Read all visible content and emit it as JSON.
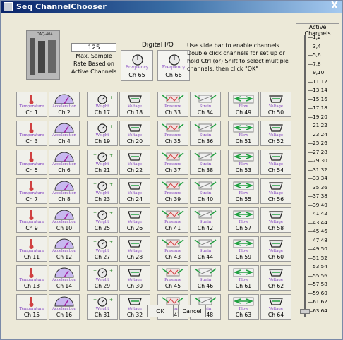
{
  "window": {
    "title": "Seq ChannelChooser",
    "close_glyph": "X"
  },
  "device": {
    "label": "DAQ-404",
    "icon": "daq-device-icon"
  },
  "sample_rate": {
    "value": "125",
    "label": "Max. Sample Rate Based on Active Channels"
  },
  "digital_io": {
    "title": "Digital I/O",
    "channels": [
      {
        "label": "Ch 65",
        "type": "Frequency",
        "icon": "frequency-icon"
      },
      {
        "label": "Ch 66",
        "type": "Frequency",
        "icon": "frequency-icon"
      }
    ]
  },
  "instructions": "Use slide bar to enable channels. Double click channels for set up or hold Ctrl (or) Shift to select multiple channels, then click \"OK\"",
  "active_channels": {
    "title": "Active Channels",
    "level": 0,
    "ticks": [
      "1,2",
      "3,4",
      "5,6",
      "7,8",
      "9,10",
      "11,12",
      "13,14",
      "15,16",
      "17,18",
      "19,20",
      "21,22",
      "23,24",
      "25,26",
      "27,28",
      "29,30",
      "31,32",
      "33,34",
      "35,36",
      "37,38",
      "39,40",
      "41,42",
      "43,44",
      "45,46",
      "47,48",
      "49,50",
      "51,52",
      "53,54",
      "55,56",
      "57,58",
      "59,60",
      "61,62",
      "63,64"
    ]
  },
  "channel_groups": [
    {
      "types": [
        "Temperature",
        "Acceleration"
      ],
      "icons": [
        "thermometer-icon",
        "gauge-icon"
      ],
      "labels": [
        "Ch 1",
        "Ch 2",
        "Ch 3",
        "Ch 4",
        "Ch 5",
        "Ch 6",
        "Ch 7",
        "Ch 8",
        "Ch 9",
        "Ch 10",
        "Ch 11",
        "Ch 12",
        "Ch 13",
        "Ch 14",
        "Ch 15",
        "Ch 16"
      ]
    },
    {
      "types": [
        "Weight",
        "Voltage"
      ],
      "icons": [
        "weight-icon",
        "voltage-icon"
      ],
      "labels": [
        "Ch 17",
        "Ch 18",
        "Ch 19",
        "Ch 20",
        "Ch 21",
        "Ch 22",
        "Ch 23",
        "Ch 24",
        "Ch 25",
        "Ch 26",
        "Ch 27",
        "Ch 28",
        "Ch 29",
        "Ch 30",
        "Ch 31",
        "Ch 32"
      ]
    },
    {
      "types": [
        "Pressure",
        "Strain"
      ],
      "icons": [
        "pressure-icon",
        "strain-icon"
      ],
      "labels": [
        "Ch 33",
        "Ch 34",
        "Ch 35",
        "Ch 36",
        "Ch 37",
        "Ch 38",
        "Ch 39",
        "Ch 40",
        "Ch 41",
        "Ch 42",
        "Ch 43",
        "Ch 44",
        "Ch 45",
        "Ch 46",
        "Ch 47",
        "Ch 48"
      ]
    },
    {
      "types": [
        "Flow",
        "Voltage"
      ],
      "icons": [
        "flow-icon",
        "voltage-icon"
      ],
      "labels": [
        "Ch 49",
        "Ch 50",
        "Ch 51",
        "Ch 52",
        "Ch 53",
        "Ch 54",
        "Ch 55",
        "Ch 56",
        "Ch 57",
        "Ch 58",
        "Ch 59",
        "Ch 60",
        "Ch 61",
        "Ch 62",
        "Ch 63",
        "Ch 64"
      ]
    }
  ],
  "buttons": {
    "ok": "OK",
    "cancel": "Cancel"
  },
  "colors": {
    "title_start": "#0a246a",
    "title_end": "#a6caf0",
    "type_text": "#8040c0"
  }
}
